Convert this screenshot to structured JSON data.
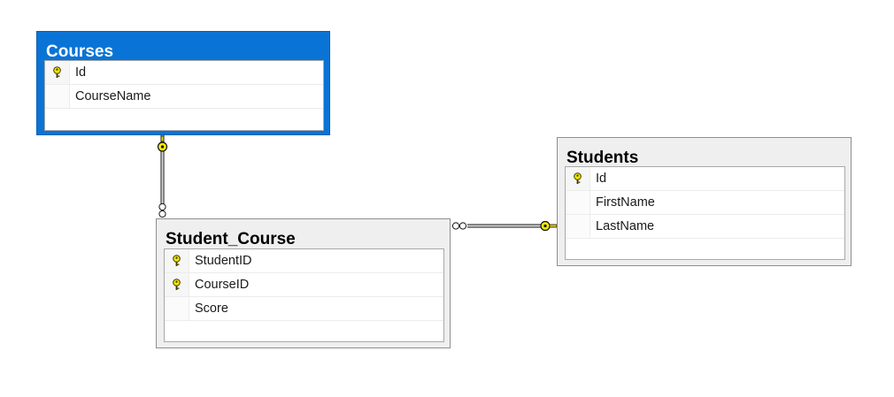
{
  "tables": {
    "courses": {
      "title": "Courses",
      "columns": [
        {
          "name": "Id",
          "primary_key": true
        },
        {
          "name": "CourseName",
          "primary_key": false
        }
      ]
    },
    "students": {
      "title": "Students",
      "columns": [
        {
          "name": "Id",
          "primary_key": true
        },
        {
          "name": "FirstName",
          "primary_key": false
        },
        {
          "name": "LastName",
          "primary_key": false
        }
      ]
    },
    "student_course": {
      "title": "Student_Course",
      "columns": [
        {
          "name": "StudentID",
          "primary_key": true
        },
        {
          "name": "CourseID",
          "primary_key": true
        },
        {
          "name": "Score",
          "primary_key": false
        }
      ]
    }
  },
  "relationships": [
    {
      "from": "Courses",
      "to": "Student_Course",
      "from_end": "key-icon",
      "to_end": "infinity-icon"
    },
    {
      "from": "Students",
      "to": "Student_Course",
      "from_end": "key-icon",
      "to_end": "infinity-icon"
    }
  ],
  "colors": {
    "selected_header": "#0a74d6",
    "table_background": "#efefef",
    "key_icon": "#f2e200"
  }
}
